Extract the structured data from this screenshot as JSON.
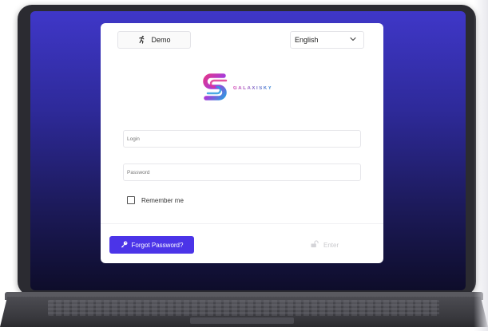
{
  "header": {
    "demo_label": "Demo",
    "language_selected": "English"
  },
  "brand": {
    "name": "GALAXISKY"
  },
  "form": {
    "login_placeholder": "Login",
    "password_placeholder": "Password",
    "remember_label": "Remember me"
  },
  "actions": {
    "forgot_label": "Forgot Password?",
    "enter_label": "Enter"
  },
  "icons": {
    "demo": "running-person-icon",
    "language": "chevron-down-icon",
    "forgot": "key-icon",
    "enter": "unlock-icon"
  },
  "colors": {
    "primary": "#4b34e8",
    "screen_top": "#3f37c8",
    "screen_bottom": "#0e0d2a",
    "logo_pink": "#d23ab0",
    "logo_blue": "#3b8fd9",
    "disabled_text": "#c9c9cd"
  }
}
